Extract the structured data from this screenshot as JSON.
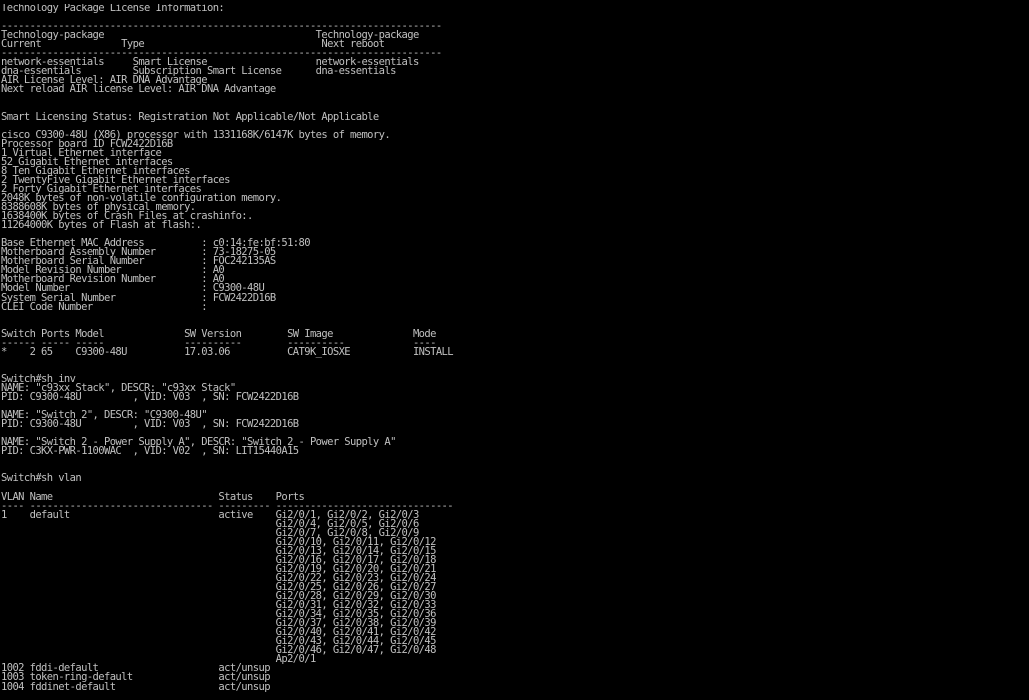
{
  "terminal": {
    "foreground": "#c0c0c0",
    "background": "#000000",
    "lines": [
      "Technology Package License Information:",
      "",
      "-----------------------------------------------------------------------------",
      "Technology-package                                     Technology-package",
      "Current              Type                               Next reboot",
      "-----------------------------------------------------------------------------",
      "network-essentials     Smart License                   network-essentials",
      "dna-essentials         Subscription Smart License      dna-essentials",
      "AIR License Level: AIR DNA Advantage",
      "Next reload AIR license Level: AIR DNA Advantage",
      "",
      "",
      "Smart Licensing Status: Registration Not Applicable/Not Applicable",
      "",
      "cisco C9300-48U (X86) processor with 1331168K/6147K bytes of memory.",
      "Processor board ID FCW2422D16B",
      "1 Virtual Ethernet interface",
      "52 Gigabit Ethernet interfaces",
      "8 Ten Gigabit Ethernet interfaces",
      "2 TwentyFive Gigabit Ethernet interfaces",
      "2 Forty Gigabit Ethernet interfaces",
      "2048K bytes of non-volatile configuration memory.",
      "8388608K bytes of physical memory.",
      "1638400K bytes of Crash Files at crashinfo:.",
      "11264000K bytes of Flash at flash:.",
      "",
      "Base Ethernet MAC Address          : c0:14:fe:bf:51:80",
      "Motherboard Assembly Number        : 73-18275-05",
      "Motherboard Serial Number          : FOC242135AS",
      "Model Revision Number              : A0",
      "Motherboard Revision Number        : A0",
      "Model Number                       : C9300-48U",
      "System Serial Number               : FCW2422D16B",
      "CLEI Code Number                   :",
      "",
      "",
      "Switch Ports Model              SW Version        SW Image              Mode",
      "------ ----- -----              ----------        ----------            ----",
      "*    2 65    C9300-48U          17.03.06          CAT9K_IOSXE           INSTALL",
      "",
      "",
      "Switch#sh inv",
      "NAME: \"c93xx Stack\", DESCR: \"c93xx Stack\"",
      "PID: C9300-48U         , VID: V03  , SN: FCW2422D16B",
      "",
      "NAME: \"Switch 2\", DESCR: \"C9300-48U\"",
      "PID: C9300-48U         , VID: V03  , SN: FCW2422D16B",
      "",
      "NAME: \"Switch 2 - Power Supply A\", DESCR: \"Switch 2 - Power Supply A\"",
      "PID: C3KX-PWR-1100WAC  , VID: V02  , SN: LIT15440A15",
      "",
      "",
      "Switch#sh vlan",
      "",
      "VLAN Name                             Status    Ports",
      "---- -------------------------------- --------- -------------------------------",
      "1    default                          active    Gi2/0/1, Gi2/0/2, Gi2/0/3",
      "                                                Gi2/0/4, Gi2/0/5, Gi2/0/6",
      "                                                Gi2/0/7, Gi2/0/8, Gi2/0/9",
      "                                                Gi2/0/10, Gi2/0/11, Gi2/0/12",
      "                                                Gi2/0/13, Gi2/0/14, Gi2/0/15",
      "                                                Gi2/0/16, Gi2/0/17, Gi2/0/18",
      "                                                Gi2/0/19, Gi2/0/20, Gi2/0/21",
      "                                                Gi2/0/22, Gi2/0/23, Gi2/0/24",
      "                                                Gi2/0/25, Gi2/0/26, Gi2/0/27",
      "                                                Gi2/0/28, Gi2/0/29, Gi2/0/30",
      "                                                Gi2/0/31, Gi2/0/32, Gi2/0/33",
      "                                                Gi2/0/34, Gi2/0/35, Gi2/0/36",
      "                                                Gi2/0/37, Gi2/0/38, Gi2/0/39",
      "                                                Gi2/0/40, Gi2/0/41, Gi2/0/42",
      "                                                Gi2/0/43, Gi2/0/44, Gi2/0/45",
      "                                                Gi2/0/46, Gi2/0/47, Gi2/0/48",
      "                                                Ap2/0/1",
      "1002 fddi-default                     act/unsup",
      "1003 token-ring-default               act/unsup",
      "1004 fddinet-default                  act/unsup"
    ]
  }
}
